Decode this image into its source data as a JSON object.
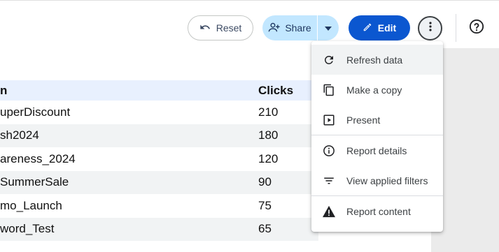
{
  "toolbar": {
    "reset_label": "Reset",
    "share_label": "Share",
    "edit_label": "Edit"
  },
  "table": {
    "headers": [
      "n",
      "Clicks"
    ],
    "rows": [
      {
        "name": "uperDiscount",
        "clicks": "210"
      },
      {
        "name": "sh2024",
        "clicks": "180"
      },
      {
        "name": "areness_2024",
        "clicks": "120"
      },
      {
        "name": "SummerSale",
        "clicks": "90"
      },
      {
        "name": "mo_Launch",
        "clicks": "75"
      },
      {
        "name": "word_Test",
        "clicks": "65"
      }
    ]
  },
  "menu": {
    "items": [
      {
        "label": "Refresh data",
        "icon": "refresh-icon"
      },
      {
        "label": "Make a copy",
        "icon": "copy-icon"
      },
      {
        "label": "Present",
        "icon": "present-icon"
      },
      {
        "label": "Report details",
        "icon": "info-icon"
      },
      {
        "label": "View applied filters",
        "icon": "filter-icon"
      },
      {
        "label": "Report content",
        "icon": "warning-icon"
      }
    ]
  },
  "colors": {
    "edit_button": "#0b57d0",
    "share_button": "#c2e7ff",
    "header_row": "#e8f0fe",
    "alt_row": "#f1f3f4"
  }
}
